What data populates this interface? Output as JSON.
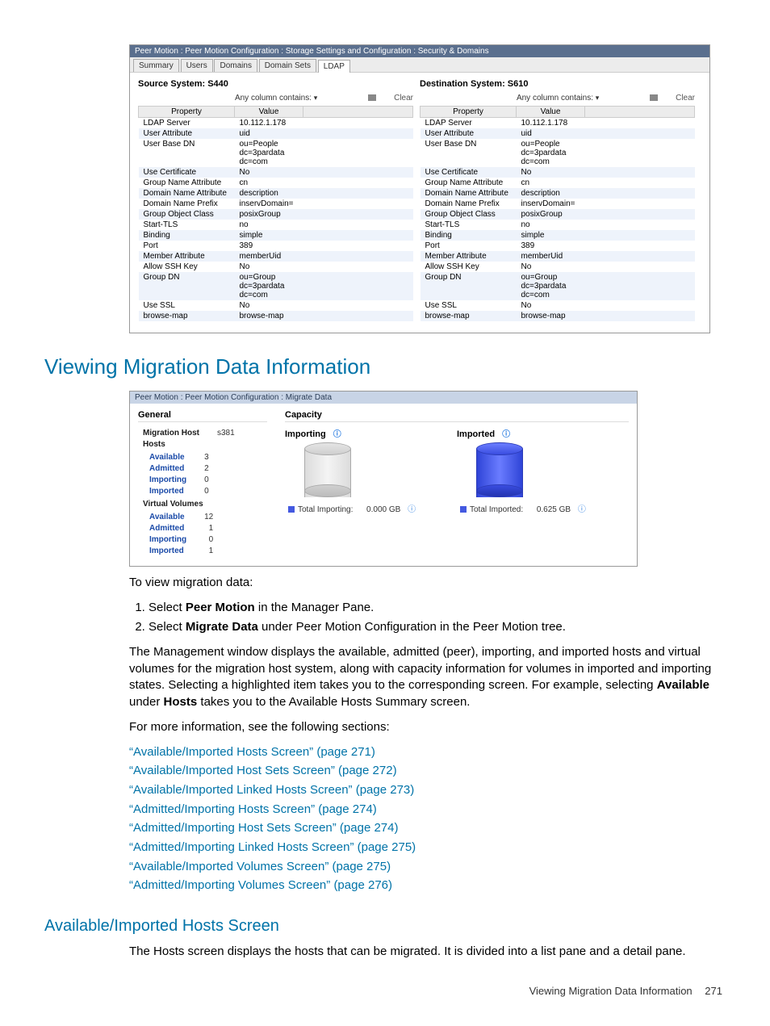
{
  "ldap": {
    "breadcrumb": "Peer Motion : Peer Motion Configuration : Storage Settings and Configuration : Security & Domains",
    "tabs": [
      "Summary",
      "Users",
      "Domains",
      "Domain Sets",
      "LDAP"
    ],
    "active_tab": "LDAP",
    "source_title": "Source System: S440",
    "dest_title": "Destination System: S610",
    "filter_label": "Any column contains:",
    "clear": "Clear",
    "col_property": "Property",
    "col_value": "Value",
    "rows": [
      {
        "p": "LDAP Server",
        "v": "10.112.1.178"
      },
      {
        "p": "User Attribute",
        "v": "uid"
      },
      {
        "p": "User Base DN",
        "v": "ou=People\ndc=3pardata\ndc=com"
      },
      {
        "p": "Use Certificate",
        "v": "No"
      },
      {
        "p": "Group Name Attribute",
        "v": "cn"
      },
      {
        "p": "Domain Name Attribute",
        "v": "description"
      },
      {
        "p": "Domain Name Prefix",
        "v": "inservDomain="
      },
      {
        "p": "Group Object Class",
        "v": "posixGroup"
      },
      {
        "p": "Start-TLS",
        "v": "no"
      },
      {
        "p": "Binding",
        "v": "simple"
      },
      {
        "p": "Port",
        "v": "389"
      },
      {
        "p": "Member Attribute",
        "v": "memberUid"
      },
      {
        "p": "Allow SSH Key",
        "v": "No"
      },
      {
        "p": "Group DN",
        "v": "ou=Group\ndc=3pardata\ndc=com"
      },
      {
        "p": "Use SSL",
        "v": "No"
      },
      {
        "p": "browse-map",
        "v": "browse-map"
      }
    ]
  },
  "section1_title": "Viewing Migration Data Information",
  "migration_panel": {
    "breadcrumb": "Peer Motion : Peer Motion Configuration : Migrate Data",
    "general_head": "General",
    "capacity_head": "Capacity",
    "host_name_label": "Migration Host",
    "host_name": "s381",
    "hosts_head": "Hosts",
    "vv_head": "Virtual Volumes",
    "rows_hosts": [
      {
        "label": "Available",
        "value": "3"
      },
      {
        "label": "Admitted",
        "value": "2"
      },
      {
        "label": "Importing",
        "value": "0"
      },
      {
        "label": "Imported",
        "value": "0"
      }
    ],
    "rows_vv": [
      {
        "label": "Available",
        "value": "12"
      },
      {
        "label": "Admitted",
        "value": "1"
      },
      {
        "label": "Importing",
        "value": "0"
      },
      {
        "label": "Imported",
        "value": "1"
      }
    ],
    "importing_title": "Importing",
    "imported_title": "Imported",
    "importing_legend": "Total Importing:",
    "importing_value": "0.000 GB",
    "imported_legend": "Total Imported:",
    "imported_value": "0.625 GB"
  },
  "intro_line": "To view migration data:",
  "step1_pre": "Select ",
  "step1_strong": "Peer Motion",
  "step1_post": " in the Manager Pane.",
  "step2_pre": "Select ",
  "step2_strong": "Migrate Data",
  "step2_post": " under Peer Motion Configuration in the Peer Motion tree.",
  "para1_a": "The Management window displays the available, admitted (peer), importing, and imported hosts and virtual volumes for the migration host system, along with capacity information for volumes in imported and importing states. Selecting a highlighted item takes you to the corresponding screen. For example, selecting ",
  "para1_b": "Available",
  "para1_c": " under ",
  "para1_d": "Hosts",
  "para1_e": " takes you to the Available Hosts Summary screen.",
  "para2": "For more information, see the following sections:",
  "links": [
    "Available/Imported Hosts Screen” (page 271)",
    "Available/Imported Host Sets Screen” (page 272)",
    "Available/Imported Linked Hosts Screen” (page 273)",
    "Admitted/Importing Hosts Screen” (page 274)",
    "Admitted/Importing Host Sets Screen” (page 274)",
    "Admitted/Importing Linked Hosts Screen” (page 275)",
    "Available/Imported Volumes Screen” (page 275)",
    "Admitted/Importing Volumes Screen” (page 276)"
  ],
  "links_plain": [
    "“Available/Imported Hosts Screen” (page 271)",
    "“Available/Imported Host Sets Screen” (page 272)",
    "“Available/Imported Linked Hosts Screen” (page 273)",
    "“Admitted/Importing Hosts Screen” (page 274)",
    "“Admitted/Importing Host Sets Screen” (page 274)",
    "“Admitted/Importing Linked Hosts Screen” (page 275)",
    "“Available/Imported Volumes Screen” (page 275)",
    "“Admitted/Importing Volumes Screen” (page 276)"
  ],
  "section2_title": "Available/Imported Hosts Screen",
  "section2_body": "The Hosts screen displays the hosts that can be migrated. It is divided into a list pane and a detail pane.",
  "footer_text": "Viewing Migration Data Information",
  "footer_page": "271",
  "chart_data": [
    {
      "type": "bar",
      "title": "Importing",
      "series": [
        {
          "name": "Total Importing",
          "values": [
            0.0
          ]
        }
      ],
      "unit": "GB"
    },
    {
      "type": "bar",
      "title": "Imported",
      "series": [
        {
          "name": "Total Imported",
          "values": [
            0.625
          ]
        }
      ],
      "unit": "GB"
    }
  ]
}
